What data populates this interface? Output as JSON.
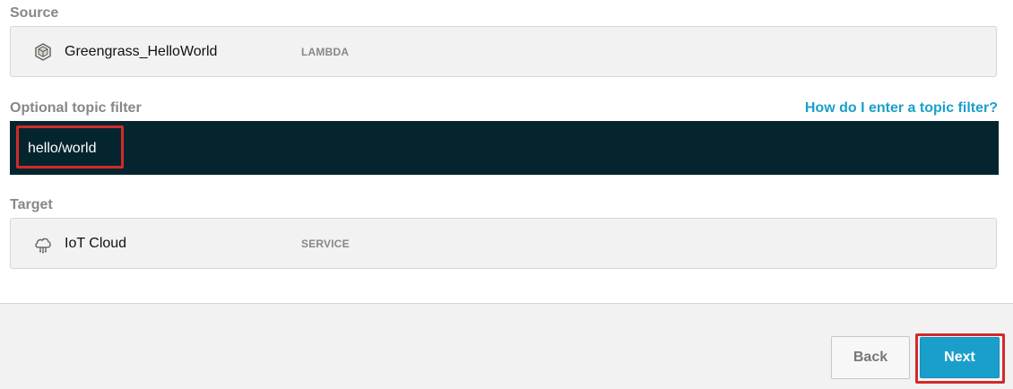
{
  "source": {
    "label": "Source",
    "name": "Greengrass_HelloWorld",
    "type": "LAMBDA",
    "icon": "lambda-cube-icon"
  },
  "topic_filter": {
    "label": "Optional topic filter",
    "help_link": "How do I enter a topic filter?",
    "value": "hello/world"
  },
  "target": {
    "label": "Target",
    "name": "IoT Cloud",
    "type": "SERVICE",
    "icon": "iot-cloud-icon"
  },
  "footer": {
    "back_label": "Back",
    "next_label": "Next"
  },
  "colors": {
    "accent": "#1a9fcc",
    "highlight": "#d12b2b",
    "input_bg": "#05252e"
  }
}
